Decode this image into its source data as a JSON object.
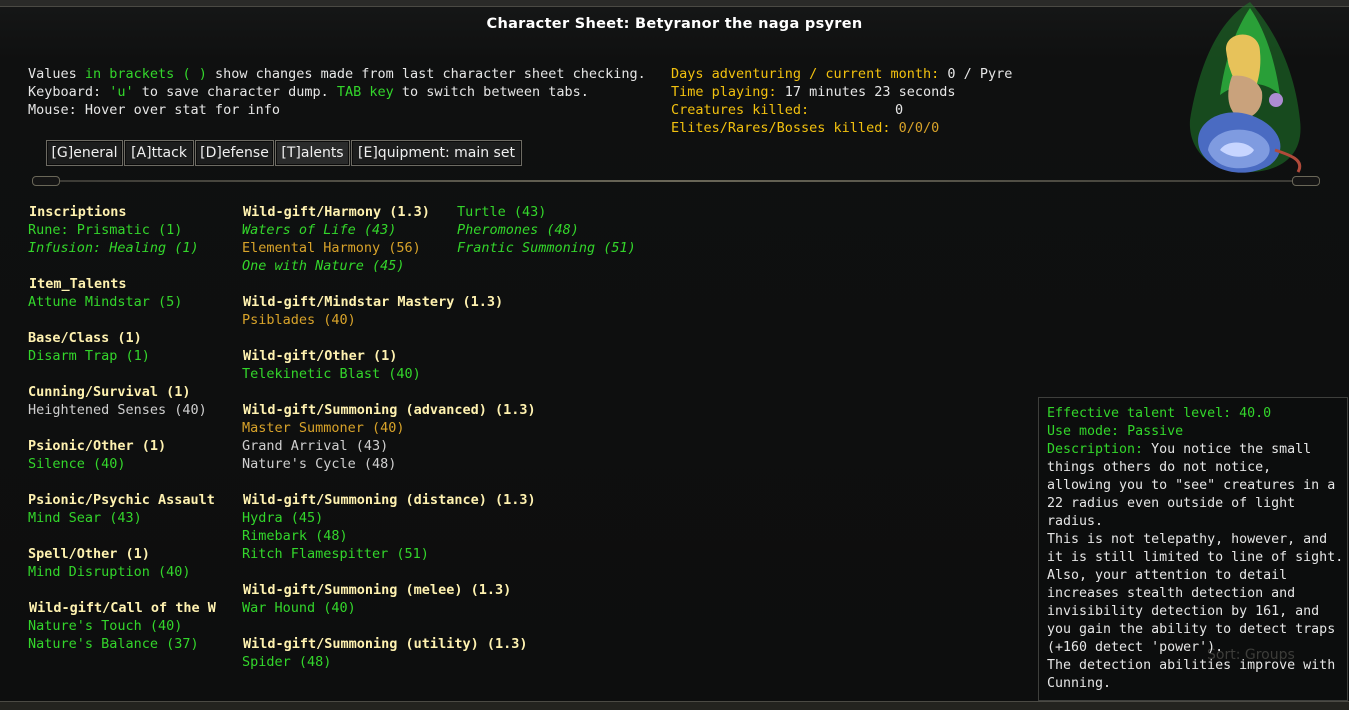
{
  "title": "Character Sheet: Betyranor the naga psyren",
  "info": {
    "values_prefix": "Values ",
    "values_bracket": "in brackets ( )",
    "values_suffix": " show changes made from last character sheet checking.",
    "keyboard_prefix": "Keyboard: ",
    "keyboard_key": "'u'",
    "keyboard_mid": " to save character dump. ",
    "keyboard_tab": "TAB key",
    "keyboard_suffix": " to switch between tabs.",
    "mouse": "Mouse: Hover over stat for info"
  },
  "stats": {
    "days_label": "Days adventuring / current month:",
    "days_value": " 0 / Pyre",
    "time_label": "Time playing:",
    "time_value": " 17 minutes 23 seconds",
    "creatures_label": "Creatures killed:",
    "creatures_value": "0",
    "elites_label": "Elites/Rares/Bosses killed:",
    "elites_value": " 0/0/0"
  },
  "tabs": [
    {
      "label": "[G]eneral"
    },
    {
      "label": "[A]ttack"
    },
    {
      "label": "[D]efense"
    },
    {
      "label": "[T]alents"
    },
    {
      "label": "[E]quipment: main set"
    }
  ],
  "col1": {
    "inscriptions": "Inscriptions",
    "rune": "Rune: Prismatic (1)",
    "infusion": "Infusion: Healing (1)",
    "item_talents": "Item_Talents",
    "attune": "Attune Mindstar (5)",
    "base_class": "Base/Class (1)",
    "disarm": "Disarm Trap (1)",
    "cunning": "Cunning/Survival (1)",
    "heightened": "Heightened Senses (40)",
    "psionic_other": "Psionic/Other (1)",
    "silence": "Silence (40)",
    "psychic_assault": "Psionic/Psychic Assault",
    "mind_sear": "Mind Sear (43)",
    "spell_other": "Spell/Other (1)",
    "mind_disruption": "Mind Disruption (40)",
    "call_of_wild": "Wild-gift/Call of the W",
    "natures_touch": "Nature's Touch (40)",
    "natures_balance": "Nature's Balance (37)"
  },
  "col2": {
    "harmony": "Wild-gift/Harmony (1.3)",
    "waters": "Waters of Life (43)",
    "elemental": "Elemental Harmony (56)",
    "one_with": "One with Nature (45)",
    "mindstar": "Wild-gift/Mindstar Mastery (1.3)",
    "psiblades": "Psiblades (40)",
    "wg_other": "Wild-gift/Other (1)",
    "telekinetic": "Telekinetic Blast (40)",
    "summ_adv": "Wild-gift/Summoning (advanced) (1.3)",
    "master_summoner": "Master Summoner (40)",
    "grand_arrival": "Grand Arrival (43)",
    "natures_cycle": "Nature's Cycle (48)",
    "summ_dist": "Wild-gift/Summoning (distance) (1.3)",
    "hydra": "Hydra (45)",
    "rimebark": "Rimebark (48)",
    "ritch": "Ritch Flamespitter (51)",
    "summ_melee": "Wild-gift/Summoning (melee) (1.3)",
    "war_hound": "War Hound (40)",
    "summ_util": "Wild-gift/Summoning (utility) (1.3)",
    "spider": "Spider (48)"
  },
  "col3": {
    "turtle": "Turtle (43)",
    "pheromones": "Pheromones (48)",
    "frantic": "Frantic Summoning (51)"
  },
  "tooltip": {
    "eff_label": "Effective talent level:",
    "eff_value": " 40.0",
    "use_label": "Use mode:",
    "use_value": " Passive",
    "desc_label": "Description:",
    "desc_first": " You notice the small",
    "lines": [
      "things others do not notice,",
      "allowing you to \"see\" creatures in a",
      "22 radius even outside of light",
      "radius.",
      "This is not telepathy, however, and",
      "it is still limited to line of sight.",
      "Also, your attention to detail",
      "increases stealth detection and",
      "invisibility detection by 161, and",
      "you gain the ability to detect traps",
      "(+160 detect 'power').",
      "The detection abilities improve with",
      "Cunning."
    ],
    "sort_hint": "Sort: Groups"
  },
  "colors": {
    "green": "#33d62b",
    "yellow": "#f2c10f",
    "orange": "#d8a32a",
    "header": "#fff2b0"
  },
  "avatar_icon": "naga-portrait-icon"
}
